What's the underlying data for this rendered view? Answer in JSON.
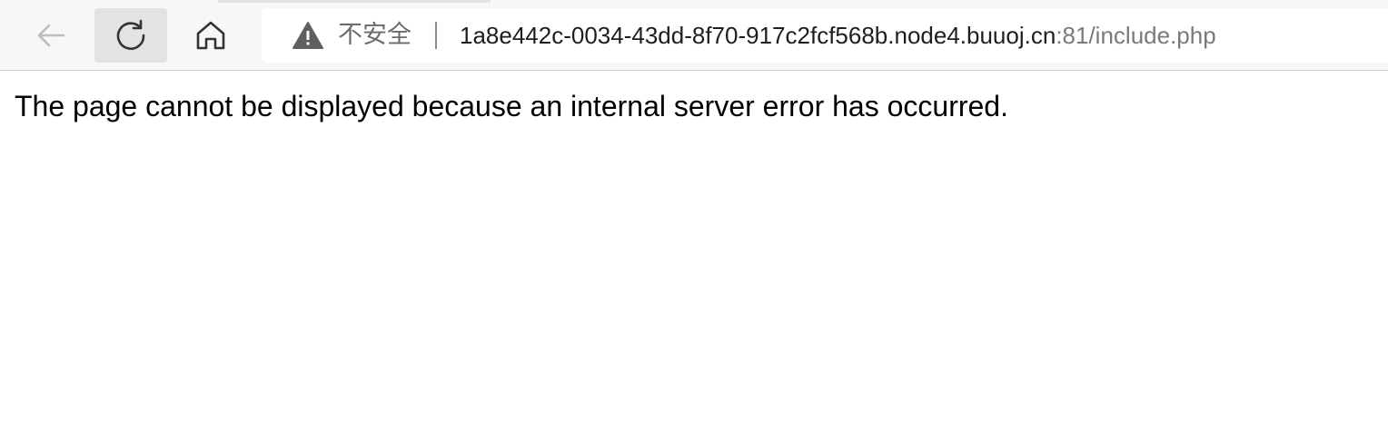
{
  "toolbar": {
    "back_icon": "arrow-left-icon",
    "refresh_icon": "refresh-icon",
    "home_icon": "home-icon"
  },
  "address_bar": {
    "security_icon": "warning-icon",
    "security_label": "不安全",
    "url_host": "1a8e442c-0034-43dd-8f70-917c2fcf568b.node4.buuoj.cn",
    "url_rest": ":81/include.php"
  },
  "page": {
    "message": "The page cannot be displayed because an internal server error has occurred."
  }
}
